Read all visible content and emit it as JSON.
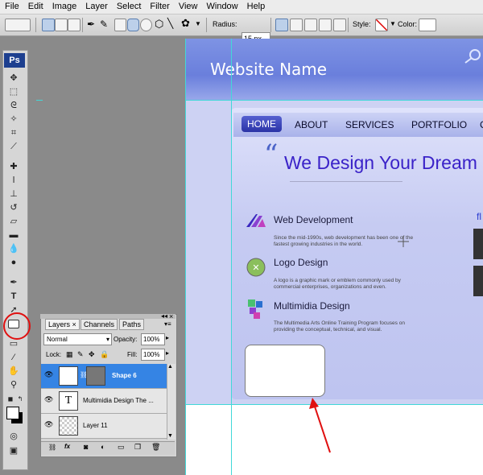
{
  "menu": [
    "File",
    "Edit",
    "Image",
    "Layer",
    "Select",
    "Filter",
    "View",
    "Window",
    "Help"
  ],
  "options_bar": {
    "radius_label": "Radius:",
    "radius_value": "15 px",
    "style_label": "Style:",
    "color_label": "Color:"
  },
  "toolbox": {
    "logo": "Ps",
    "type_tool": "T"
  },
  "website": {
    "title": "Website Name",
    "nav": [
      "HOME",
      "ABOUT",
      "SERVICES",
      "PORTFOLIO",
      "C"
    ],
    "headline": "We Design Your Dream",
    "quote_mark": "“",
    "services": [
      {
        "title": "Web Development",
        "desc": "Since the mid-1990s, web development has been one of the fastest growing industries in the world."
      },
      {
        "title": "Logo Design",
        "desc": "A logo is a graphic mark or emblem commonly used by commercial enterprises, organizations and even."
      },
      {
        "title": "Multimidia Design",
        "desc": "The Multimedia Arts Online Training Program focuses on providing the conceptual, technical, and visual."
      }
    ],
    "side_text": "fl"
  },
  "layers_panel": {
    "tabs": [
      "Layers",
      "Channels",
      "Paths"
    ],
    "blend_mode": "Normal",
    "opacity_label": "Opacity:",
    "opacity_value": "100%",
    "lock_label": "Lock:",
    "fill_label": "Fill:",
    "fill_value": "100%",
    "layers": [
      {
        "name": "Shape 6",
        "selected": true
      },
      {
        "name": "Multimidia Design  The ...",
        "selected": false
      },
      {
        "name": "Layer 11",
        "selected": false
      }
    ],
    "footer_icons": [
      "link-icon",
      "fx-icon",
      "mask-icon",
      "adjustment-icon",
      "group-icon",
      "new-layer-icon",
      "trash-icon"
    ]
  },
  "colors": {
    "selection": "#3584e4",
    "guide": "#41d8d8",
    "highlight_circle": "#e01010",
    "headline": "#3a22c8"
  }
}
